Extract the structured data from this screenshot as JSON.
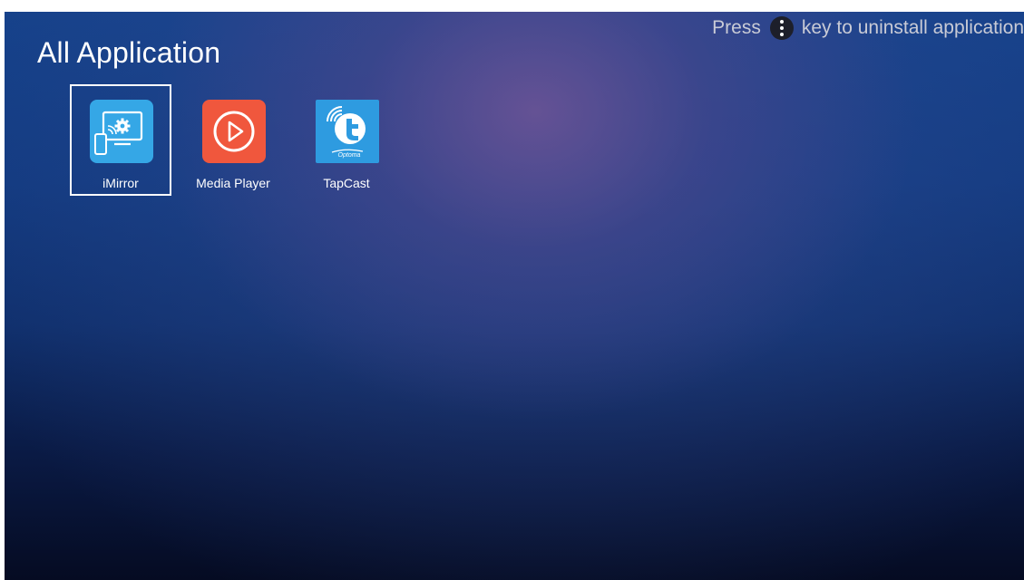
{
  "header": {
    "title": "All Application",
    "hint_prefix": "Press",
    "hint_key_icon": "more-vertical-icon",
    "hint_suffix": "key to uninstall application"
  },
  "apps": [
    {
      "label": "iMirror",
      "icon": "imirror-icon",
      "selected": true,
      "color": "#35a7e6"
    },
    {
      "label": "Media Player",
      "icon": "media-player-icon",
      "selected": false,
      "color": "#f0573d"
    },
    {
      "label": "TapCast",
      "icon": "tapcast-icon",
      "selected": false,
      "color": "#2e9be0",
      "brand_text": "Optoma"
    }
  ]
}
